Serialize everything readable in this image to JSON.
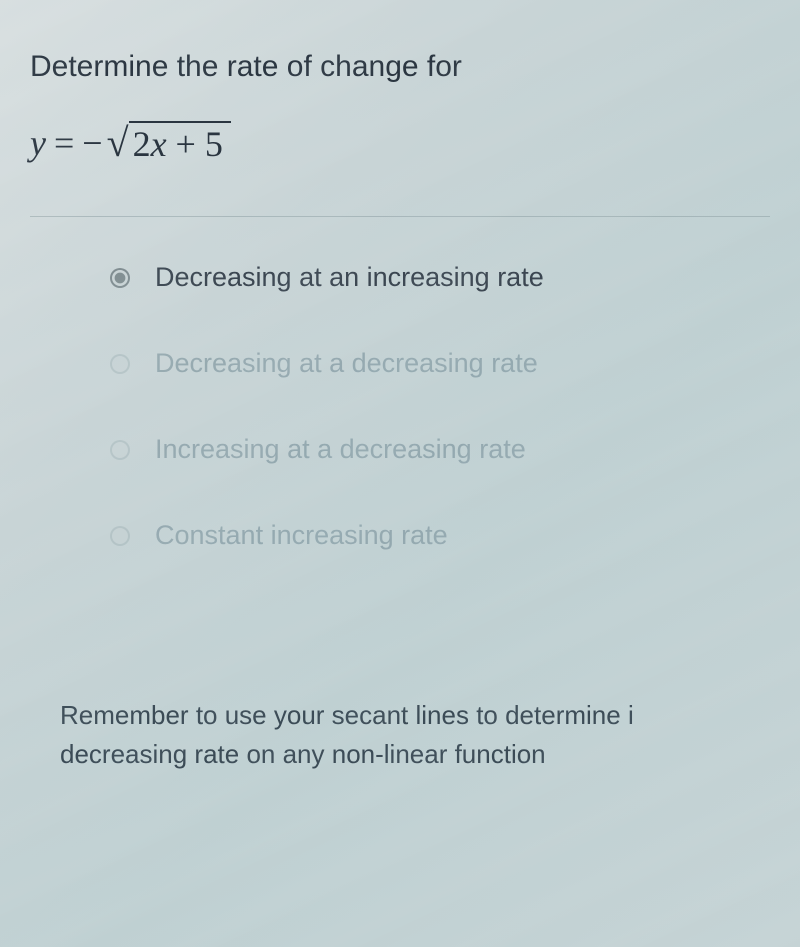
{
  "question": {
    "prompt": "Determine the rate of change for",
    "equation": {
      "lhs": "y",
      "equals": "=",
      "negative": "−",
      "radicand_coeff": "2",
      "radicand_var": "x",
      "radicand_plus": "+",
      "radicand_const": "5"
    }
  },
  "options": [
    {
      "label": "Decreasing at an increasing rate",
      "selected": true,
      "faded": false
    },
    {
      "label": "Decreasing at a decreasing rate",
      "selected": false,
      "faded": true
    },
    {
      "label": "Increasing at a decreasing rate",
      "selected": false,
      "faded": true
    },
    {
      "label": "Constant increasing rate",
      "selected": false,
      "faded": true
    }
  ],
  "hint": {
    "line1": "Remember to use your secant lines to determine i",
    "line2": "decreasing rate on any non-linear function"
  }
}
